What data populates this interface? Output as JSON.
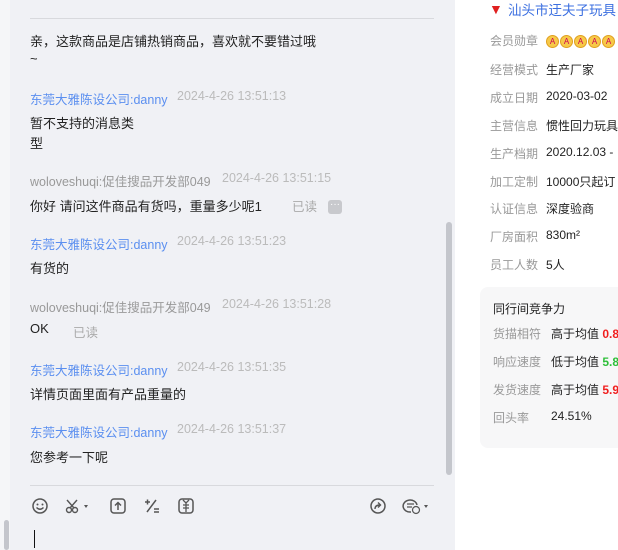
{
  "chat": {
    "first_message": {
      "text": "亲，这款商品是店铺热销商品，喜欢就不要错过哦",
      "text_line2": "~"
    },
    "messages": [
      {
        "sender": "东莞大雅陈设公司:danny",
        "time": "2024-4-26 13:51:13",
        "text": "暂不支持的消息类",
        "text_line2": "型"
      },
      {
        "sender": "woloveshuqi:促佳搜品开发部049",
        "time": "2024-4-26 13:51:15",
        "text": "你好 请问这件商品有货吗，重量多少呢1",
        "status": "已读"
      },
      {
        "sender": "东莞大雅陈设公司:danny",
        "time": "2024-4-26 13:51:23",
        "text": "有货的"
      },
      {
        "sender": "woloveshuqi:促佳搜品开发部049",
        "time": "2024-4-26 13:51:28",
        "text": "OK",
        "status": "已读"
      },
      {
        "sender": "东莞大雅陈设公司:danny",
        "time": "2024-4-26 13:51:35",
        "text": "详情页面里面有产品重量的"
      },
      {
        "sender": "东莞大雅陈设公司:danny",
        "time": "2024-4-26 13:51:37",
        "text": "您参考一下呢"
      }
    ],
    "more_glyph": "···"
  },
  "company": {
    "name": "汕头市迂夫子玩具",
    "rows": [
      {
        "label": "会员勋章",
        "value": ""
      },
      {
        "label": "经营模式",
        "value": "生产厂家"
      },
      {
        "label": "成立日期",
        "value": "2020-03-02"
      },
      {
        "label": "主营信息",
        "value": "惯性回力玩具"
      },
      {
        "label": "生产档期",
        "value": "2020.12.03 -"
      },
      {
        "label": "加工定制",
        "value": "10000只起订"
      },
      {
        "label": "认证信息",
        "value": "深度验商"
      },
      {
        "label": "厂房面积",
        "value": "830m²"
      },
      {
        "label": "员工人数",
        "value": "5人"
      }
    ],
    "medal_count": 5,
    "medal_letter": "A"
  },
  "competitiveness": {
    "title": "同行间竞争力",
    "rows": [
      {
        "label": "货描相符",
        "compare": "高于均值",
        "value": "0.8"
      },
      {
        "label": "响应速度",
        "compare": "低于均值",
        "value": "5.8"
      },
      {
        "label": "发货速度",
        "compare": "高于均值",
        "value": "5.9"
      },
      {
        "label": "回头率",
        "compare": "24.51%",
        "value": ""
      }
    ],
    "colors": {
      "up": "#f01e1e",
      "down": "#2fbf3a"
    }
  }
}
